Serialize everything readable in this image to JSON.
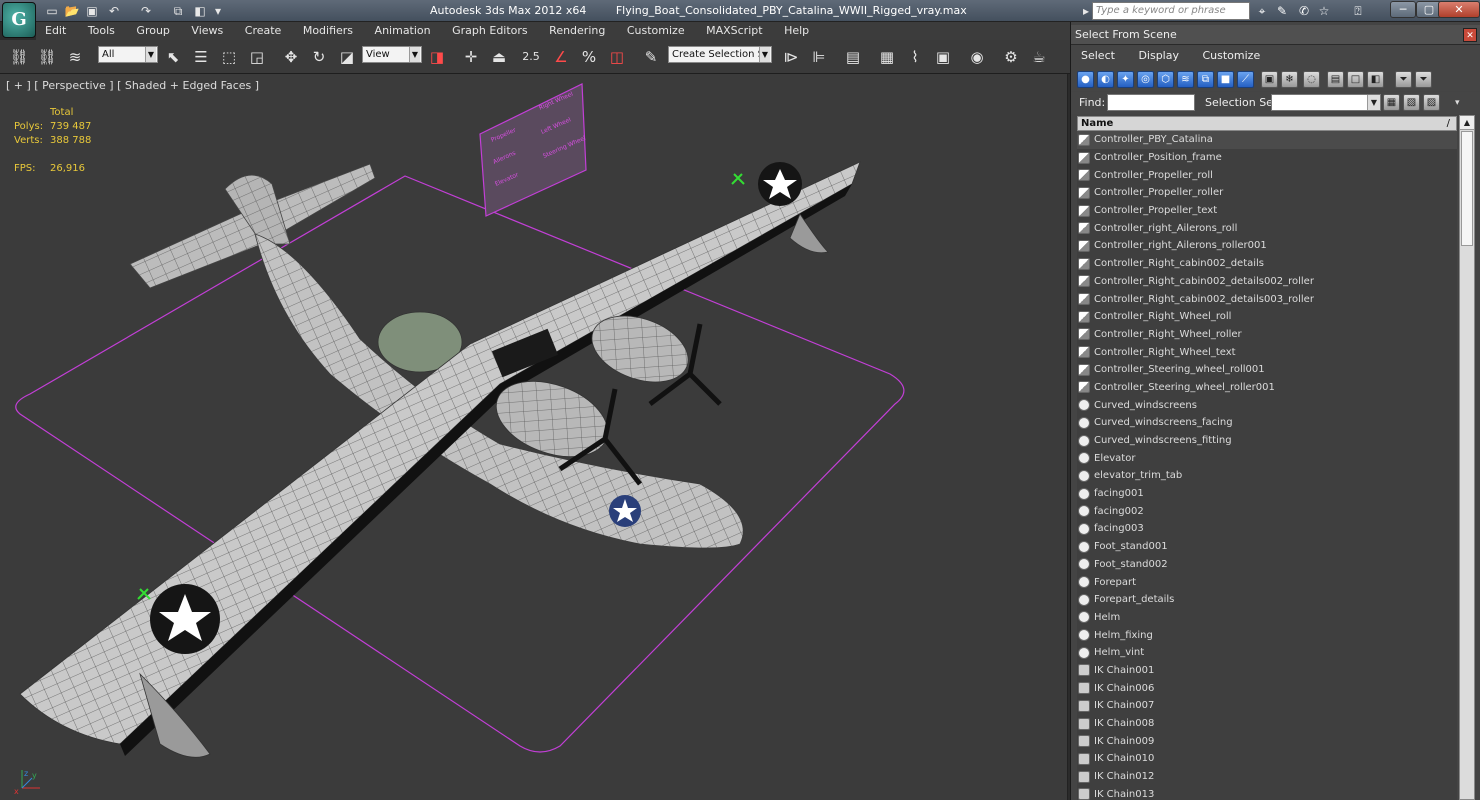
{
  "titlebar": {
    "app": "Autodesk 3ds Max  2012 x64",
    "file": "Flying_Boat_Consolidated_PBY_Catalina_WWII_Rigged_vray.max",
    "search_placeholder": "Type a keyword or phrase",
    "logo": "G"
  },
  "menu": [
    "Edit",
    "Tools",
    "Group",
    "Views",
    "Create",
    "Modifiers",
    "Animation",
    "Graph Editors",
    "Rendering",
    "Customize",
    "MAXScript",
    "Help"
  ],
  "toolbar": {
    "filter_value": "All",
    "refcoord_value": "View",
    "snap_value": "2.5",
    "angle_snap_label": "%",
    "selection_set_placeholder": "Create Selection Se"
  },
  "viewport": {
    "label": "[ + ] [ Perspective ] [ Shaded + Edged Faces ]",
    "stats": {
      "header": "Total",
      "polys_label": "Polys:",
      "polys": "739 487",
      "verts_label": "Verts:",
      "verts": "388 788",
      "fps_label": "FPS:",
      "fps": "26,916"
    },
    "axis": {
      "x": "x",
      "y": "y",
      "z": "z"
    },
    "control_panel_labels": {
      "propeller": "Propeller",
      "ailerons": "Ailerons",
      "elevator": "Elevator",
      "right_wheel": "Right Wheel",
      "left_wheel": "Left Wheel",
      "steering_wheel": "Steering Wheel"
    }
  },
  "panel": {
    "title": "Select From Scene",
    "menu": [
      "Select",
      "Display",
      "Customize"
    ],
    "find_label": "Find:",
    "selection_set_label": "Selection Set:",
    "column_header": "Name",
    "items": [
      {
        "name": "Controller_PBY_Catalina",
        "type": "ctrl"
      },
      {
        "name": "Controller_Position_frame",
        "type": "ctrl"
      },
      {
        "name": "Controller_Propeller_roll",
        "type": "ctrl"
      },
      {
        "name": "Controller_Propeller_roller",
        "type": "ctrl"
      },
      {
        "name": "Controller_Propeller_text",
        "type": "ctrl"
      },
      {
        "name": "Controller_right_Ailerons_roll",
        "type": "ctrl"
      },
      {
        "name": "Controller_right_Ailerons_roller001",
        "type": "ctrl"
      },
      {
        "name": "Controller_Right_cabin002_details",
        "type": "ctrl"
      },
      {
        "name": "Controller_Right_cabin002_details002_roller",
        "type": "ctrl"
      },
      {
        "name": "Controller_Right_cabin002_details003_roller",
        "type": "ctrl"
      },
      {
        "name": "Controller_Right_Wheel_roll",
        "type": "ctrl"
      },
      {
        "name": "Controller_Right_Wheel_roller",
        "type": "ctrl"
      },
      {
        "name": "Controller_Right_Wheel_text",
        "type": "ctrl"
      },
      {
        "name": "Controller_Steering_wheel_roll001",
        "type": "ctrl"
      },
      {
        "name": "Controller_Steering_wheel_roller001",
        "type": "ctrl"
      },
      {
        "name": "Curved_windscreens",
        "type": "geo"
      },
      {
        "name": "Curved_windscreens_facing",
        "type": "geo"
      },
      {
        "name": "Curved_windscreens_fitting",
        "type": "geo"
      },
      {
        "name": "Elevator",
        "type": "geo"
      },
      {
        "name": "elevator_trim_tab",
        "type": "geo"
      },
      {
        "name": "facing001",
        "type": "geo"
      },
      {
        "name": "facing002",
        "type": "geo"
      },
      {
        "name": "facing003",
        "type": "geo"
      },
      {
        "name": "Foot_stand001",
        "type": "geo"
      },
      {
        "name": "Foot_stand002",
        "type": "geo"
      },
      {
        "name": "Forepart",
        "type": "geo"
      },
      {
        "name": "Forepart_details",
        "type": "geo"
      },
      {
        "name": "Helm",
        "type": "geo"
      },
      {
        "name": "Helm_fixing",
        "type": "geo"
      },
      {
        "name": "Helm_vint",
        "type": "geo"
      },
      {
        "name": "IK Chain001",
        "type": "bone"
      },
      {
        "name": "IK Chain006",
        "type": "bone"
      },
      {
        "name": "IK Chain007",
        "type": "bone"
      },
      {
        "name": "IK Chain008",
        "type": "bone"
      },
      {
        "name": "IK Chain009",
        "type": "bone"
      },
      {
        "name": "IK Chain010",
        "type": "bone"
      },
      {
        "name": "IK Chain012",
        "type": "bone"
      },
      {
        "name": "IK Chain013",
        "type": "bone"
      }
    ]
  },
  "colors": {
    "stats_text": "#e8c83a",
    "selection_outline": "#c23fd6",
    "gizmo_green": "#33dd33",
    "insignia_blue": "#2a3f7a"
  }
}
